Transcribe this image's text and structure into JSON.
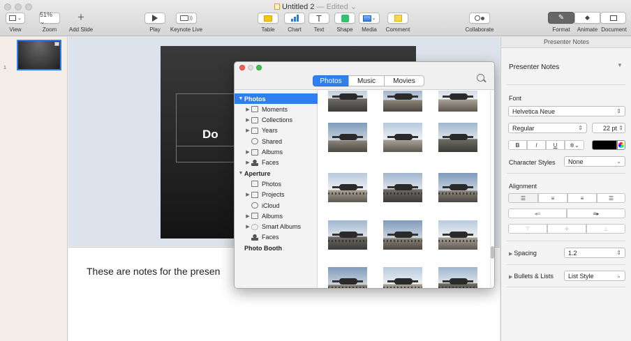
{
  "window": {
    "title": "Untitled 2",
    "edited": "— Edited ⌄"
  },
  "toolbar": {
    "zoom_value": "51% ⌄",
    "labels": {
      "view": "View",
      "zoom": "Zoom",
      "add_slide": "Add Slide",
      "play": "Play",
      "keynote_live": "Keynote Live",
      "table": "Table",
      "chart": "Chart",
      "text": "Text",
      "shape": "Shape",
      "media": "Media",
      "comment": "Comment",
      "collaborate": "Collaborate",
      "format": "Format",
      "animate": "Animate",
      "document": "Document"
    },
    "colors": {
      "accent": "#f5c518",
      "chart": "#2d7be5",
      "shape": "#2fc36b"
    }
  },
  "navigator": {
    "slide_number": "1"
  },
  "slide": {
    "title_fragment": "Do"
  },
  "notes": {
    "text": "These are notes for the presen"
  },
  "media_browser": {
    "tabs": [
      "Photos",
      "Music",
      "Movies"
    ],
    "active_tab": "Photos",
    "sidebar": [
      {
        "label": "Photos",
        "level": 0,
        "tri": "▼",
        "icon": "",
        "selected": true,
        "bold": true
      },
      {
        "label": "Moments",
        "level": 1,
        "tri": "▶",
        "icon": "folder"
      },
      {
        "label": "Collections",
        "level": 1,
        "tri": "▶",
        "icon": "folder"
      },
      {
        "label": "Years",
        "level": 1,
        "tri": "▶",
        "icon": "folder"
      },
      {
        "label": "Shared",
        "level": 1,
        "tri": "",
        "icon": "cloud"
      },
      {
        "label": "Albums",
        "level": 1,
        "tri": "▶",
        "icon": "folder"
      },
      {
        "label": "Faces",
        "level": 1,
        "tri": "▶",
        "icon": "person"
      },
      {
        "label": "Aperture",
        "level": 0,
        "tri": "▼",
        "icon": "",
        "bold": true
      },
      {
        "label": "Photos",
        "level": 1,
        "tri": "",
        "icon": "folder"
      },
      {
        "label": "Projects",
        "level": 1,
        "tri": "▶",
        "icon": "folder"
      },
      {
        "label": "iCloud",
        "level": 1,
        "tri": "",
        "icon": "cloud"
      },
      {
        "label": "Albums",
        "level": 1,
        "tri": "▶",
        "icon": "folder"
      },
      {
        "label": "Smart Albums",
        "level": 1,
        "tri": "▶",
        "icon": "gear"
      },
      {
        "label": "Faces",
        "level": 1,
        "tri": "",
        "icon": "person"
      },
      {
        "label": "Photo Booth",
        "level": 0,
        "tri": "",
        "icon": "",
        "bold": true
      }
    ]
  },
  "inspector": {
    "header": "Presenter Notes",
    "style_dropdown": "Presenter Notes",
    "font_label": "Font",
    "font_family": "Helvetica Neue",
    "font_style": "Regular",
    "font_size": "22 pt",
    "bold": "B",
    "italic": "I",
    "underline": "U",
    "char_styles_label": "Character Styles",
    "char_styles_value": "None",
    "alignment_label": "Alignment",
    "spacing_label": "Spacing",
    "spacing_value": "1.2",
    "bullets_label": "Bullets & Lists",
    "bullets_value": "List Style",
    "text_color": "#000000"
  }
}
